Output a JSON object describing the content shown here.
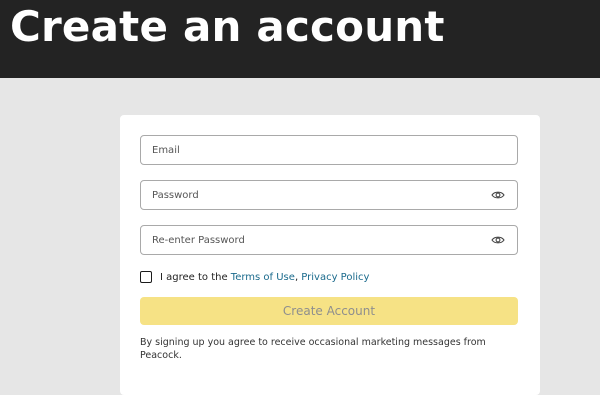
{
  "header": {
    "title": "Create an account"
  },
  "form": {
    "email_placeholder": "Email",
    "password_placeholder": "Password",
    "reenter_password_placeholder": "Re-enter Password",
    "password_toggle_icon": "eye-icon",
    "agree": {
      "prefix": "I agree to the ",
      "terms_link": "Terms of Use",
      "separator": ", ",
      "privacy_link": "Privacy Policy"
    },
    "submit_label": "Create Account",
    "disclaimer": "By signing up you agree to receive occasional marketing messages from Peacock."
  },
  "colors": {
    "header_bg": "#232323",
    "page_bg": "#e6e6e6",
    "button_bg": "#f6e285",
    "link": "#1a6a8c"
  }
}
